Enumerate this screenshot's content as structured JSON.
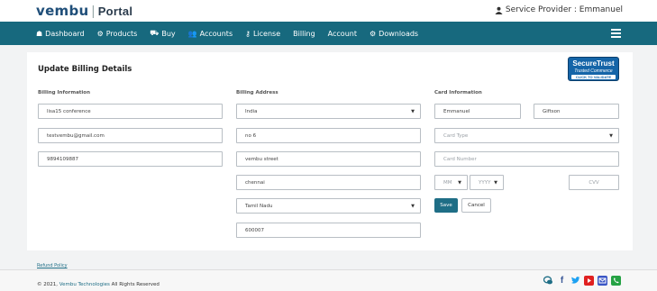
{
  "header": {
    "logo_text": "vembu",
    "portal_label": "Portal",
    "provider_label": "Service Provider : Emmanuel"
  },
  "nav": {
    "items": [
      {
        "label": "Dashboard",
        "icon": "dashboard-icon",
        "glyph": "☗"
      },
      {
        "label": "Products",
        "icon": "products-icon",
        "glyph": "⚙"
      },
      {
        "label": "Buy",
        "icon": "cart-icon",
        "glyph": "⛟"
      },
      {
        "label": "Accounts",
        "icon": "accounts-icon",
        "glyph": "👥"
      },
      {
        "label": "License",
        "icon": "key-icon",
        "glyph": "⚷"
      },
      {
        "label": "Billing",
        "icon": "",
        "glyph": ""
      },
      {
        "label": "Account",
        "icon": "",
        "glyph": ""
      },
      {
        "label": "Downloads",
        "icon": "downloads-icon",
        "glyph": "⚙"
      }
    ]
  },
  "page": {
    "title": "Update Billing Details",
    "trust_badge": {
      "line1": "SecureTrust",
      "line2": "Trusted Commerce",
      "line3": "CLICK TO VALIDATE"
    }
  },
  "billing_information": {
    "label": "Billing Information",
    "name": "lisa15 conference",
    "email": "testvembu@gmail.com",
    "phone": "9894109887"
  },
  "billing_address": {
    "label": "Billing Address",
    "country": "India",
    "line1": "no 6",
    "line2": "vembu street",
    "city": "chennai",
    "state": "Tamil Nadu",
    "zip": "600007"
  },
  "card_information": {
    "label": "Card Information",
    "first_name": "Emmanuel",
    "last_name": "Giftson",
    "card_type_placeholder": "Card Type",
    "card_number_placeholder": "Card Number",
    "month_placeholder": "MM",
    "year_placeholder": "YYYY",
    "cvv_placeholder": "CVV"
  },
  "actions": {
    "save": "Save",
    "cancel": "Cancel"
  },
  "refund_link": "Refund Policy",
  "footer": {
    "copyright_prefix": "© 2021,",
    "company": "Vembu Technologies",
    "copyright_suffix": "All Rights Reserved",
    "social": [
      {
        "icon": "chat-icon",
        "color": "#1f6e86"
      },
      {
        "icon": "facebook-icon",
        "color": "#3b5998"
      },
      {
        "icon": "twitter-icon",
        "color": "#1da1f2"
      },
      {
        "icon": "youtube-icon",
        "color": "#e02020"
      },
      {
        "icon": "email-icon",
        "color": "#3a56c5"
      },
      {
        "icon": "whatsapp-icon",
        "color": "#25a244"
      }
    ]
  },
  "colors": {
    "nav_bg": "#17697e",
    "accent": "#1f6e86"
  }
}
